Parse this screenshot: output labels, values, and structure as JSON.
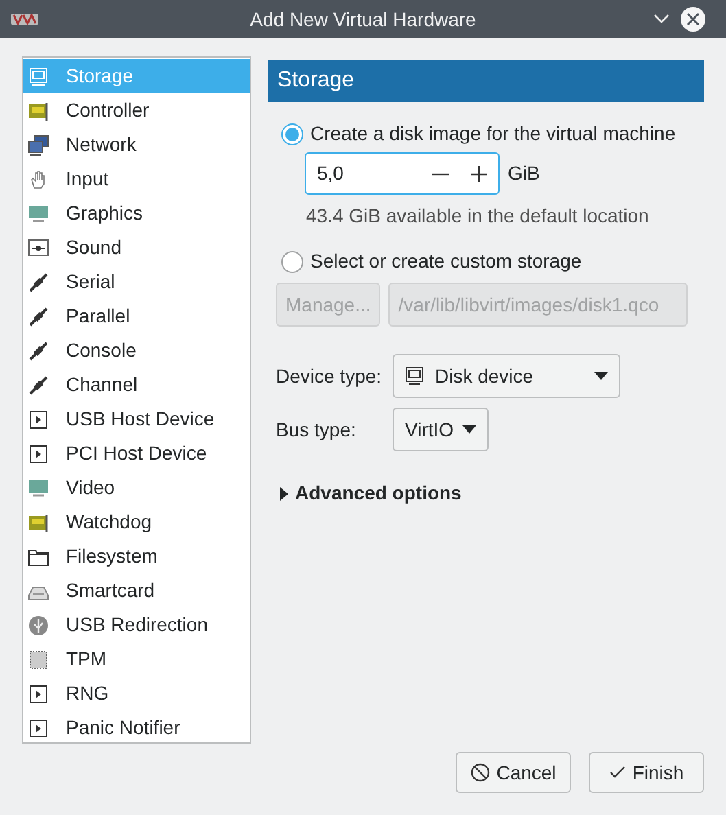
{
  "window": {
    "title": "Add New Virtual Hardware"
  },
  "sidebar": {
    "items": [
      {
        "label": "Storage",
        "kind": "disk",
        "selected": true
      },
      {
        "label": "Controller",
        "kind": "card",
        "selected": false
      },
      {
        "label": "Network",
        "kind": "network",
        "selected": false
      },
      {
        "label": "Input",
        "kind": "hand",
        "selected": false
      },
      {
        "label": "Graphics",
        "kind": "monitor",
        "selected": false
      },
      {
        "label": "Sound",
        "kind": "sound",
        "selected": false
      },
      {
        "label": "Serial",
        "kind": "cable",
        "selected": false
      },
      {
        "label": "Parallel",
        "kind": "cable",
        "selected": false
      },
      {
        "label": "Console",
        "kind": "cable",
        "selected": false
      },
      {
        "label": "Channel",
        "kind": "cable",
        "selected": false
      },
      {
        "label": "USB Host Device",
        "kind": "device",
        "selected": false
      },
      {
        "label": "PCI Host Device",
        "kind": "device",
        "selected": false
      },
      {
        "label": "Video",
        "kind": "monitor",
        "selected": false
      },
      {
        "label": "Watchdog",
        "kind": "card",
        "selected": false
      },
      {
        "label": "Filesystem",
        "kind": "folder",
        "selected": false
      },
      {
        "label": "Smartcard",
        "kind": "reader",
        "selected": false
      },
      {
        "label": "USB Redirection",
        "kind": "usb",
        "selected": false
      },
      {
        "label": "TPM",
        "kind": "chip",
        "selected": false
      },
      {
        "label": "RNG",
        "kind": "device",
        "selected": false
      },
      {
        "label": "Panic Notifier",
        "kind": "device",
        "selected": false
      }
    ]
  },
  "panel": {
    "title": "Storage",
    "create_option": {
      "label": "Create a disk image for the virtual machine",
      "selected": true
    },
    "size": {
      "value": "5,0",
      "unit": "GiB"
    },
    "available": "43.4 GiB available in the default location",
    "custom_option": {
      "label": "Select or create custom storage",
      "selected": false
    },
    "manage_button": {
      "label": "Manage...",
      "disabled": true
    },
    "path": {
      "value": "/var/lib/libvirt/images/disk1.qco",
      "disabled": true
    },
    "device_type": {
      "label": "Device type:",
      "value": "Disk device"
    },
    "bus_type": {
      "label": "Bus type:",
      "value": "VirtIO"
    },
    "advanced": {
      "label": "Advanced options",
      "expanded": false
    }
  },
  "buttons": [
    {
      "label": "Cancel",
      "kind": "cancel"
    },
    {
      "label": "Finish",
      "kind": "finish"
    }
  ]
}
